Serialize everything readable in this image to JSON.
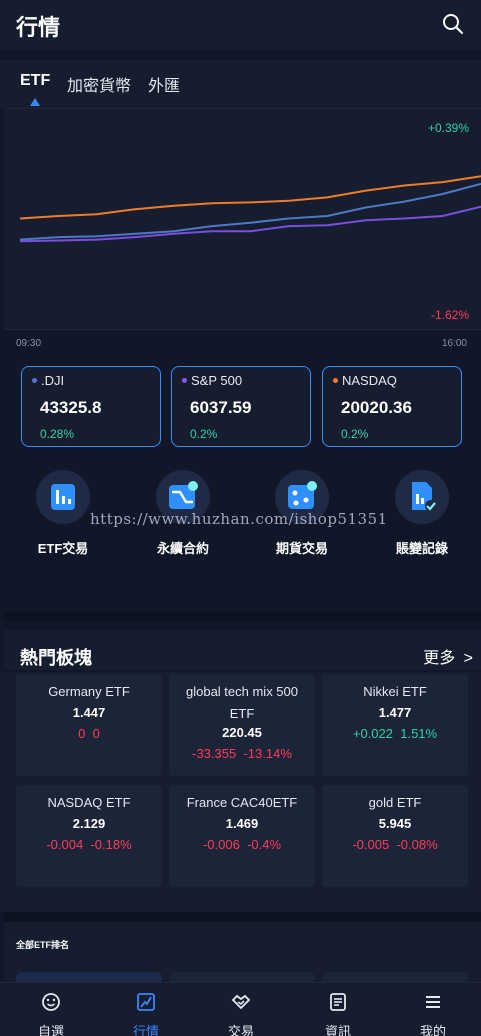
{
  "header": {
    "title": "行情"
  },
  "tabs": [
    {
      "label": "ETF",
      "active": true
    },
    {
      "label": "加密貨幣",
      "active": false
    },
    {
      "label": "外匯",
      "active": false
    }
  ],
  "chart": {
    "max_label": "+0.39%",
    "min_label": "-1.62%",
    "time_start": "09:30",
    "time_end": "16:00"
  },
  "chart_data": {
    "type": "line",
    "x": [
      "09:30",
      "16:00"
    ],
    "ylim": [
      -1.62,
      0.39
    ],
    "series": [
      {
        "color": "#f07b2a",
        "values": [
          -0.55,
          -0.52,
          -0.5,
          -0.44,
          -0.4,
          -0.37,
          -0.36,
          -0.34,
          -0.3,
          -0.22,
          -0.16,
          -0.12,
          -0.05
        ]
      },
      {
        "color": "#4f77c7",
        "values": [
          -0.8,
          -0.77,
          -0.76,
          -0.73,
          -0.7,
          -0.64,
          -0.6,
          -0.55,
          -0.52,
          -0.42,
          -0.35,
          -0.26,
          -0.14
        ]
      },
      {
        "color": "#7a4fe0",
        "values": [
          -0.82,
          -0.81,
          -0.8,
          -0.77,
          -0.73,
          -0.7,
          -0.7,
          -0.64,
          -0.63,
          -0.57,
          -0.55,
          -0.52,
          -0.41
        ]
      }
    ]
  },
  "indices": [
    {
      "name": ".DJI",
      "value": "43325.8",
      "change": "0.28%",
      "dot_color": "#4f77c7"
    },
    {
      "name": "S&P 500",
      "value": "6037.59",
      "change": "0.2%",
      "dot_color": "#8a55ff"
    },
    {
      "name": "NASDAQ",
      "value": "20020.36",
      "change": "0.2%",
      "dot_color": "#f07b2a"
    }
  ],
  "quick_actions": [
    {
      "label": "ETF交易",
      "icon": "etf-chart-icon"
    },
    {
      "label": "永續合約",
      "icon": "perpetual-contract-icon"
    },
    {
      "label": "期貨交易",
      "icon": "futures-dice-icon"
    },
    {
      "label": "賬變記錄",
      "icon": "record-document-icon"
    }
  ],
  "watermark": "https://www.huzhan.com/ishop51351",
  "hot": {
    "title": "熱門板塊",
    "more_label": "更多",
    "items": [
      {
        "name": "Germany ETF",
        "price": "1.447",
        "change": "0",
        "percent": "0",
        "dir": "down"
      },
      {
        "name": "global tech mix 500 ETF",
        "price": "220.45",
        "change": "-33.355",
        "percent": "-13.14%",
        "dir": "down"
      },
      {
        "name": "Nikkei ETF",
        "price": "1.477",
        "change": "+0.022",
        "percent": "1.51%",
        "dir": "up"
      },
      {
        "name": "NASDAQ ETF",
        "price": "2.129",
        "change": "-0.004",
        "percent": "-0.18%",
        "dir": "down"
      },
      {
        "name": "France CAC40ETF",
        "price": "1.469",
        "change": "-0.006",
        "percent": "-0.4%",
        "dir": "down"
      },
      {
        "name": "gold ETF",
        "price": "5.945",
        "change": "-0.005",
        "percent": "-0.08%",
        "dir": "down"
      }
    ]
  },
  "ranking": {
    "title": "全部ETF排名"
  },
  "nav": [
    {
      "label": "自選",
      "icon": "smiley-icon",
      "active": false
    },
    {
      "label": "行情",
      "icon": "market-chart-icon",
      "active": true
    },
    {
      "label": "交易",
      "icon": "trade-handshake-icon",
      "active": false
    },
    {
      "label": "資訊",
      "icon": "news-icon",
      "active": false
    },
    {
      "label": "我的",
      "icon": "menu-icon",
      "active": false
    }
  ],
  "colors": {
    "accent": "#3a86ff",
    "up": "#2bd4a4",
    "down": "#ff3b5c",
    "background": "#111728"
  }
}
